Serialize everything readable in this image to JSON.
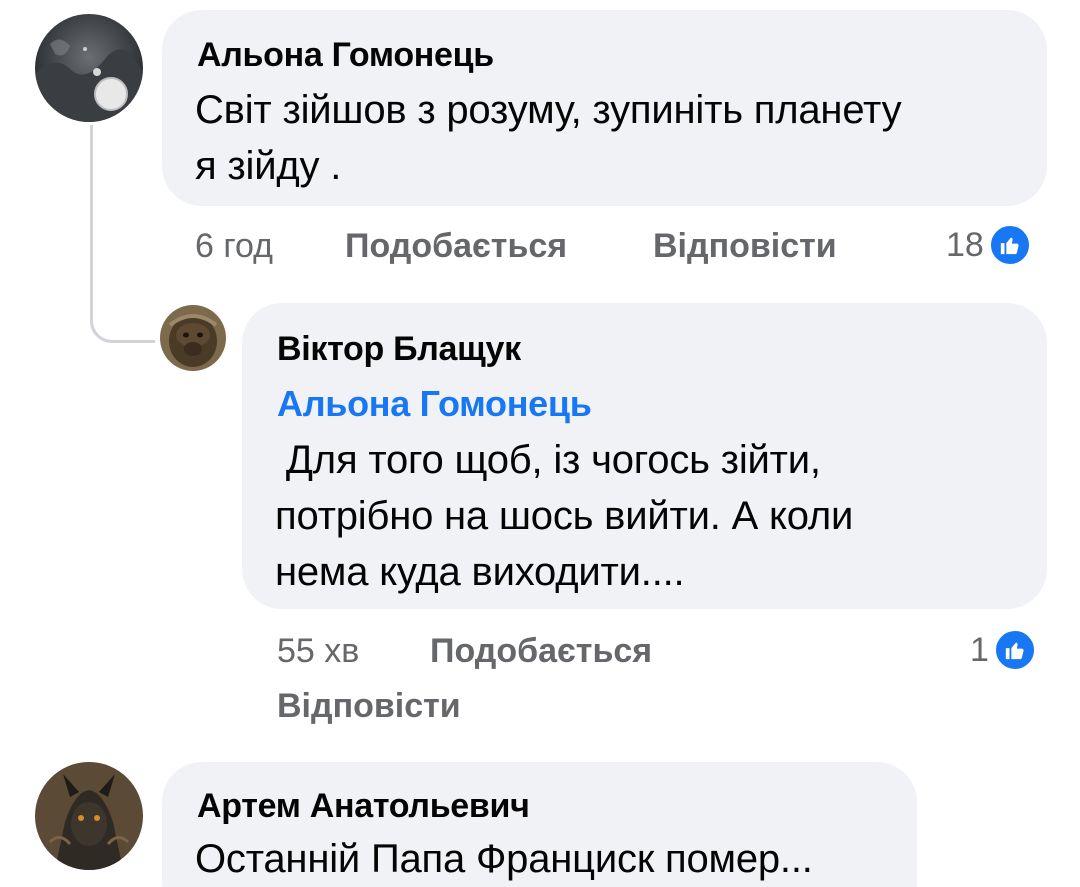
{
  "comments": [
    {
      "author": "Альона Гомонець",
      "lines": [
        "Світ зійшов з розуму, зупиніть планету",
        "я зійду ."
      ],
      "time": "6 год",
      "like_label": "Подобається",
      "reply_label": "Відповісти",
      "reaction_count": "18",
      "avatar_icon": "moon-night-avatar-icon"
    },
    {
      "author": "Віктор Блащук",
      "mention": "Альона Гомонець",
      "lines": [
        " Для того щоб, із чогось зійти,",
        "потрібно на шось вийти. А коли",
        "нема куда виходити...."
      ],
      "time": "55 хв",
      "like_label": "Подобається",
      "reply_label": "Відповісти",
      "reaction_count": "1",
      "avatar_icon": "gorilla-avatar-icon"
    },
    {
      "author": "Артем Анатольевич",
      "lines": [
        "Останній Папа Франциск помер..."
      ],
      "avatar_icon": "dragon-avatar-icon"
    }
  ],
  "colors": {
    "bubble": "#f0f2f5",
    "text": "#050505",
    "meta": "#65676b",
    "mention": "#1877f2",
    "like_badge": "#1877f2"
  },
  "icons": {
    "like": "thumbs-up-icon"
  }
}
